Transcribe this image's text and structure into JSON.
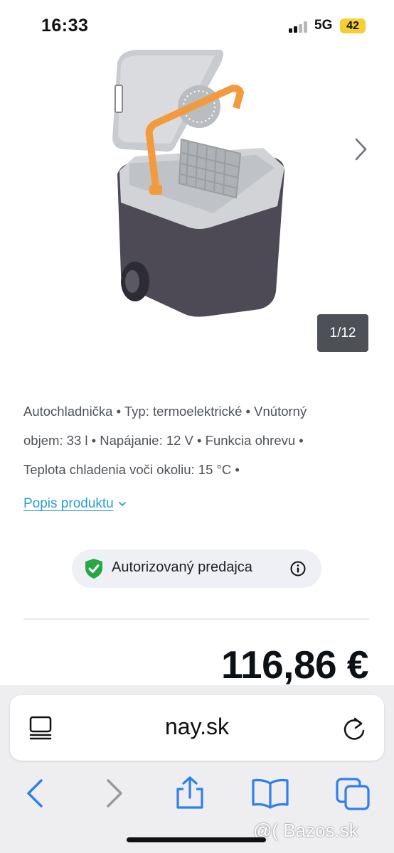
{
  "status_bar": {
    "time": "16:33",
    "network": "5G",
    "battery": "42"
  },
  "gallery": {
    "counter": "1/12"
  },
  "product": {
    "description_lines": [
      "Autochladnička • Typ: termoelektrické • Vnútorný",
      "objem: 33 l • Napájanie: 12 V • Funkcia ohrevu •",
      "Teplota chladenia voči okoliu: 15 °C •"
    ],
    "description_link": "Popis produktu",
    "dealer_badge": "Autorizovaný predajca",
    "price": "116,86 €"
  },
  "browser": {
    "url": "nay.sk"
  },
  "watermark": "@( Bazos.sk",
  "colors": {
    "accent": "#2b9bd5",
    "shield": "#27a844",
    "battery": "#f5cf33",
    "handle": "#f39a3c",
    "body": "#4d4a55"
  }
}
